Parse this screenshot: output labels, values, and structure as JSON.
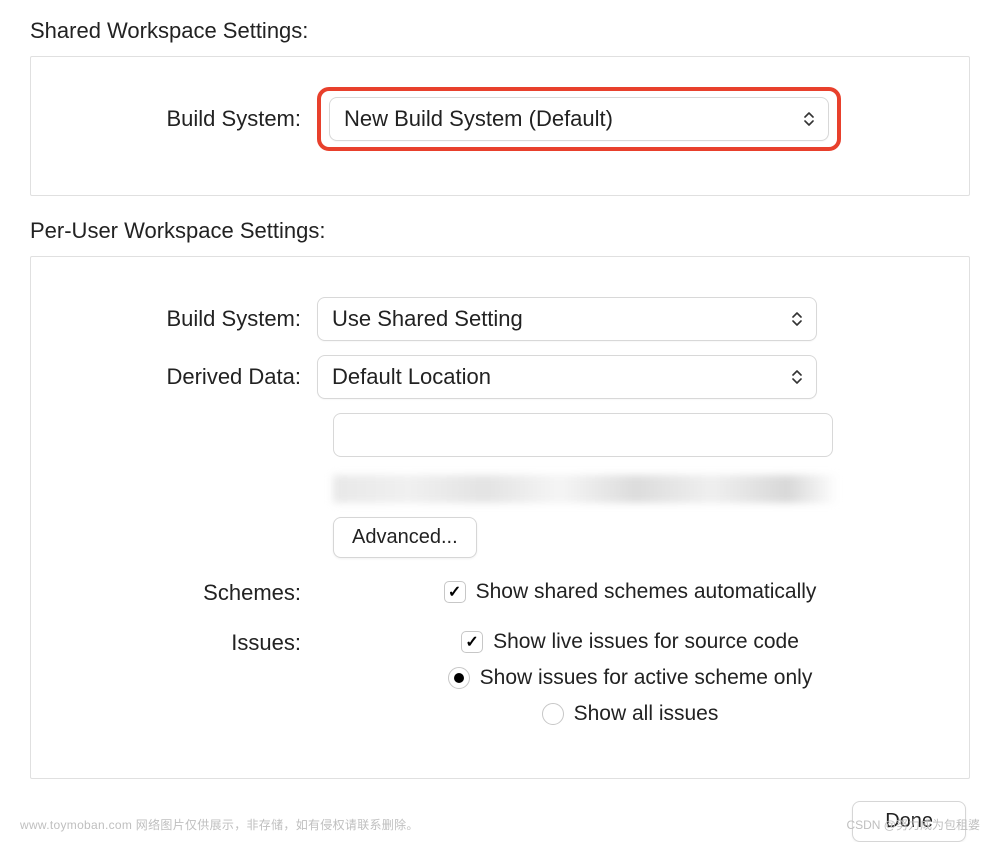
{
  "shared": {
    "title": "Shared Workspace Settings:",
    "build_system_label": "Build System:",
    "build_system_value": "New Build System (Default)"
  },
  "peruser": {
    "title": "Per-User Workspace Settings:",
    "build_system_label": "Build System:",
    "build_system_value": "Use Shared Setting",
    "derived_data_label": "Derived Data:",
    "derived_data_value": "Default Location",
    "advanced_button": "Advanced...",
    "schemes_label": "Schemes:",
    "schemes_option": "Show shared schemes automatically",
    "issues_label": "Issues:",
    "issues_live": "Show live issues for source code",
    "issues_active": "Show issues for active scheme only",
    "issues_all": "Show all issues"
  },
  "footer": {
    "done_button": "Done"
  },
  "watermark": {
    "left": "www.toymoban.com 网络图片仅供展示，非存储，如有侵权请联系删除。",
    "right": "CSDN @努力成为包租婆"
  }
}
